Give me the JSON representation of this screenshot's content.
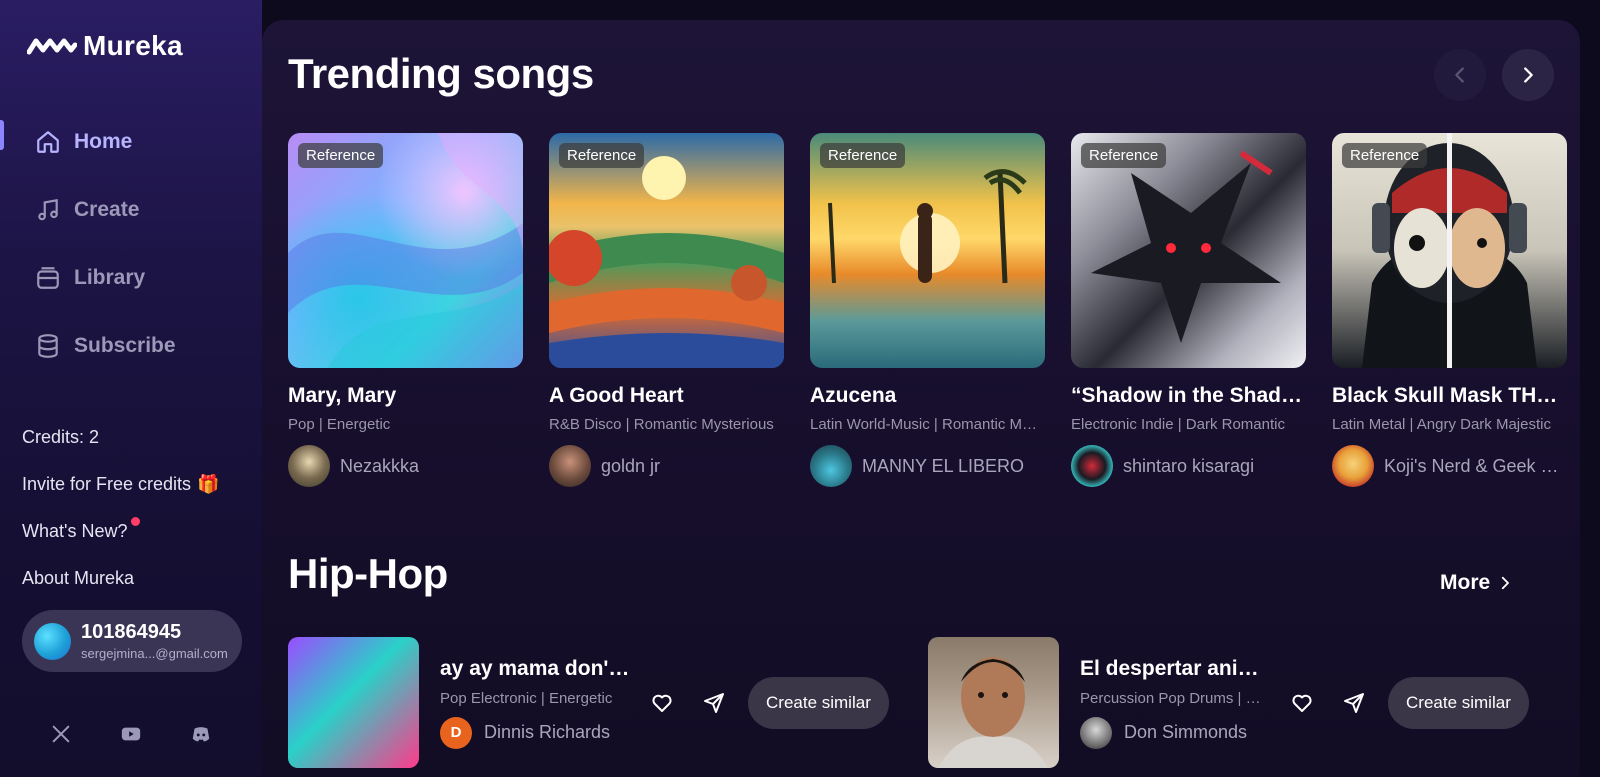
{
  "app": {
    "name": "Mureka"
  },
  "sidebar": {
    "nav": [
      {
        "label": "Home",
        "icon": "home-icon",
        "active": true
      },
      {
        "label": "Create",
        "icon": "music-note-icon",
        "active": false
      },
      {
        "label": "Library",
        "icon": "library-icon",
        "active": false
      },
      {
        "label": "Subscribe",
        "icon": "database-icon",
        "active": false
      }
    ],
    "credits": "Credits: 2",
    "invite": "Invite for Free credits",
    "whats_new": "What's New?",
    "about": "About Mureka",
    "account": {
      "id": "101864945",
      "email": "sergejmina...@gmail.com"
    },
    "socials": [
      "x-icon",
      "youtube-icon",
      "discord-icon"
    ]
  },
  "trending": {
    "title": "Trending songs",
    "badge": "Reference",
    "songs": [
      {
        "title": "Mary, Mary",
        "tags": "Pop | Energetic",
        "artist": "Nezakkka"
      },
      {
        "title": "A Good Heart",
        "tags": "R&B Disco | Romantic Mysterious",
        "artist": "goldn jr"
      },
      {
        "title": "Azucena",
        "tags": "Latin World-Music | Romantic Melancholic",
        "artist": "MANNY EL LIBERO"
      },
      {
        "title": "“Shadow in the Shadows”",
        "tags": "Electronic Indie | Dark Romantic",
        "artist": "shintaro kisaragi"
      },
      {
        "title": "Black Skull Mask THE HERO",
        "tags": "Latin Metal | Angry Dark Majestic",
        "artist": "Koji's Nerd & Geek World"
      }
    ]
  },
  "hiphop": {
    "title": "Hip-Hop",
    "more": "More",
    "create_label": "Create similar",
    "songs": [
      {
        "title": "ay ay mama don't stop",
        "tags": "Pop Electronic | Energetic",
        "artist": "Dinnis Richards",
        "avatar_letter": "D"
      },
      {
        "title": "El despertar animal",
        "tags": "Percussion Pop Drums | Energetic",
        "artist": "Don Simmonds"
      }
    ]
  },
  "colors": {
    "accent": "#8b86ff",
    "background": "#0d0a1e",
    "panel": "#1d1437"
  }
}
